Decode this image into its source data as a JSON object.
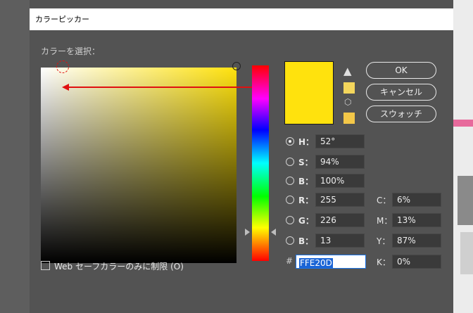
{
  "dialog": {
    "title": "カラーピッカー",
    "section_label": "カラーを選択："
  },
  "colors": {
    "selected": "#FFE20D",
    "annotation": "#E01010",
    "warning_swatch": "#F4D65C",
    "websafe_swatch": "#F3C748"
  },
  "icons": {
    "warning": "warning-triangle-icon",
    "cube": "websafe-cube-icon"
  },
  "buttons": {
    "ok": "OK",
    "cancel": "キャンセル",
    "swatches": "スウォッチ"
  },
  "hsb": [
    {
      "label": "H：",
      "value": "52°",
      "selected": true
    },
    {
      "label": "S：",
      "value": "94%",
      "selected": false
    },
    {
      "label": "B：",
      "value": "100%",
      "selected": false
    }
  ],
  "rgb": [
    {
      "label": "R：",
      "value": "255",
      "selected": false
    },
    {
      "label": "G：",
      "value": "226",
      "selected": false
    },
    {
      "label": "B：",
      "value": "13",
      "selected": false
    }
  ],
  "cmyk": [
    {
      "label": "C：",
      "value": "6%"
    },
    {
      "label": "M：",
      "value": "13%"
    },
    {
      "label": "Y：",
      "value": "87%"
    },
    {
      "label": "K：",
      "value": "0%"
    }
  ],
  "hex": {
    "prefix": "#",
    "value": "FFE20D"
  },
  "websafe": {
    "label": "Web セーフカラーのみに制限 (O)",
    "checked": false
  }
}
